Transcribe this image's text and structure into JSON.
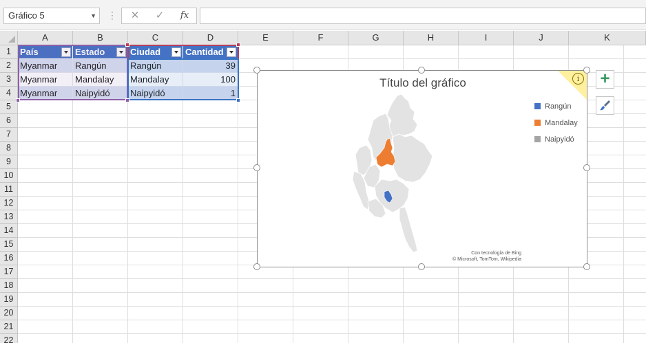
{
  "formula_bar": {
    "name_box": "Gráfico 5",
    "more_icon": "⋮",
    "cancel_icon": "✕",
    "enter_icon": "✓",
    "fx_label": "fx",
    "formula_value": ""
  },
  "columns": [
    "A",
    "B",
    "C",
    "D",
    "E",
    "F",
    "G",
    "H",
    "I",
    "J",
    "K"
  ],
  "rows": [
    "1",
    "2",
    "3",
    "4",
    "5",
    "6",
    "7",
    "8",
    "9",
    "10",
    "11",
    "12",
    "13",
    "14",
    "15",
    "16",
    "17",
    "18",
    "19",
    "20",
    "21",
    "22"
  ],
  "table": {
    "headers": [
      "País",
      "Estado",
      "Ciudad",
      "Cantidad"
    ],
    "rows": [
      [
        "Myanmar",
        "Rangún",
        "Rangún",
        "39"
      ],
      [
        "Myanmar",
        "Mandalay",
        "Mandalay",
        "100"
      ],
      [
        "Myanmar",
        "Naipyidó",
        "Naipyidó",
        "1"
      ]
    ]
  },
  "chart": {
    "title": "Título del gráfico",
    "legend": [
      {
        "label": "Rangún",
        "color": "#4472c4"
      },
      {
        "label": "Mandalay",
        "color": "#ed7d31"
      },
      {
        "label": "Naipyidó",
        "color": "#a5a5a5"
      }
    ],
    "credit_line1": "Con tecnología de Bing",
    "credit_line2": "© Microsoft, TomTom, Wikipedia",
    "info_glyph": "i",
    "map_fill": "#e3e3e3",
    "map_border": "#ffffff"
  },
  "side_buttons": {
    "add_element": "+",
    "styles_icon": "paintbrush-icon"
  },
  "colors": {
    "table_header": "#4472c4",
    "band": "#d9e1f2",
    "selection_purple": "#8e5fa8",
    "selection_red": "#b8405a",
    "selection_blue": "#3a72c4"
  }
}
